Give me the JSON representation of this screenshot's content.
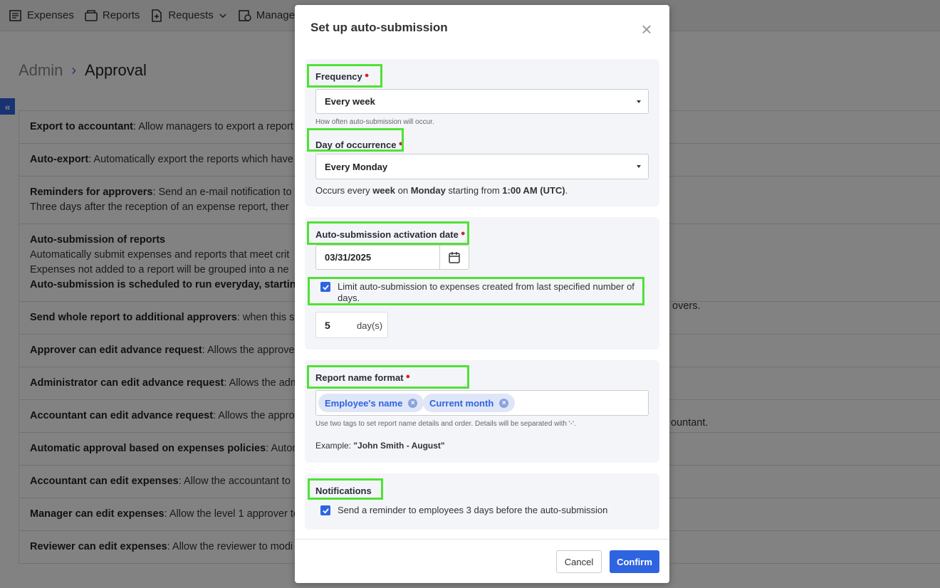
{
  "nav": {
    "items": [
      {
        "label": "Expenses"
      },
      {
        "label": "Reports"
      },
      {
        "label": "Requests"
      },
      {
        "label": "Manager"
      }
    ]
  },
  "breadcrumb": {
    "parent": "Admin",
    "current": "Approval"
  },
  "settings": [
    {
      "title": "Export to accountant",
      "desc": ": Allow managers to export a report"
    },
    {
      "title": "Auto-export",
      "desc": ": Automatically export the reports which have"
    },
    {
      "title": "Reminders for approvers",
      "desc": ": Send an e-mail notification to t",
      "line2": "Three days after the reception of an expense report, ther"
    },
    {
      "title": "Auto-submission of reports",
      "line2": "Automatically submit expenses and reports that meet crit",
      "line3": "Expenses not added to a report will be grouped into a ne",
      "line4": "Auto-submission is scheduled to run everyday, starting"
    },
    {
      "title": "Send whole report to additional approvers",
      "desc": ": when this se",
      "right": "overs."
    },
    {
      "title": "Approver can edit advance request",
      "desc": ": Allows the approve"
    },
    {
      "title": "Administrator can edit advance request",
      "desc": ": Allows the adm"
    },
    {
      "title": "Accountant can edit advance request",
      "desc": ": Allows the appro"
    },
    {
      "title": "Automatic approval based on expenses policies",
      "desc": ": Autom",
      "right": "ountant."
    },
    {
      "title": "Accountant can edit expenses",
      "desc": ": Allow the accountant to"
    },
    {
      "title": "Manager can edit expenses",
      "desc": ": Allow the level 1 approver to"
    },
    {
      "title": "Reviewer can edit expenses",
      "desc": ": Allow the reviewer to modi"
    }
  ],
  "modal": {
    "title": "Set up auto-submission",
    "frequency": {
      "label": "Frequency",
      "value": "Every week",
      "help": "How often auto-submission will occur."
    },
    "day": {
      "label": "Day of occurrence",
      "value": "Every Monday",
      "info_prefix": "Occurs every ",
      "info_freq": "week",
      "info_mid1": " on ",
      "info_day": "Monday",
      "info_mid2": " starting from ",
      "info_time": "1:00 AM (UTC)",
      "info_suffix": "."
    },
    "activation": {
      "label": "Auto-submission activation date",
      "date": "03/31/2025",
      "limit_label": "Limit auto-submission to expenses created from last specified number of days.",
      "limit_checked": true,
      "days_value": "5",
      "days_unit": "day(s)"
    },
    "report_name": {
      "label": "Report name format",
      "tags": [
        "Employee's name",
        "Current month"
      ],
      "help": "Use two tags to set report name details and order. Details will be separated with '-'.",
      "example_prefix": "Example: ",
      "example_value": "\"John Smith - August\""
    },
    "notifications": {
      "label": "Notifications",
      "reminder_label": "Send a reminder to employees 3 days before the auto-submission",
      "reminder_checked": true
    },
    "buttons": {
      "cancel": "Cancel",
      "confirm": "Confirm"
    }
  },
  "colors": {
    "accent": "#2f64e0",
    "highlight": "#4fe236",
    "required": "#d0242b"
  }
}
